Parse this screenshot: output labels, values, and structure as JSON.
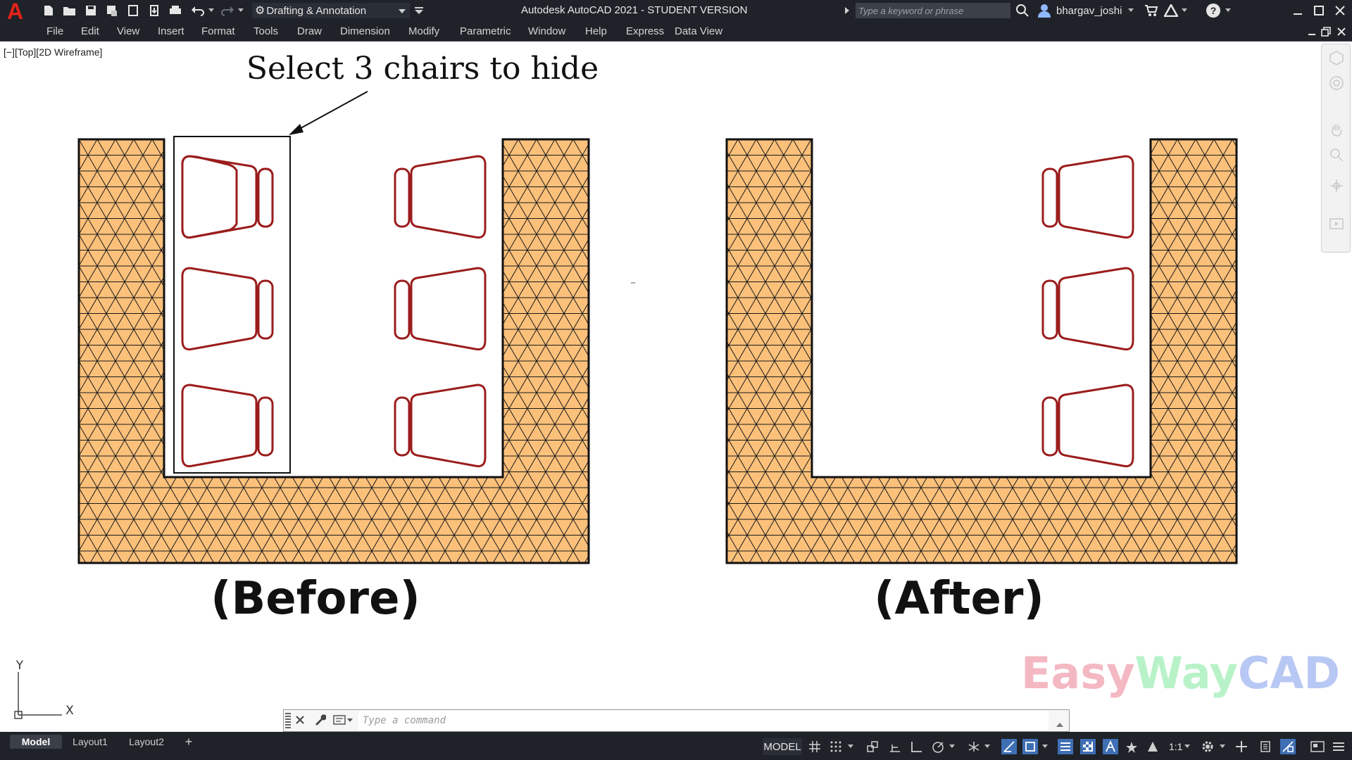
{
  "app": {
    "title": "Autodesk AutoCAD 2021 - STUDENT VERSION",
    "logo_letter": "A",
    "workspace": "Drafting & Annotation",
    "search_placeholder": "Type a keyword or phrase",
    "user": "bhargav_joshi",
    "help_symbol": "?"
  },
  "menu": [
    "File",
    "Edit",
    "View",
    "Insert",
    "Format",
    "Tools",
    "Draw",
    "Dimension",
    "Modify",
    "Parametric",
    "Window",
    "Help",
    "Express",
    "Data View"
  ],
  "viewport": {
    "label": "[−][Top][2D Wireframe]"
  },
  "drawing": {
    "annotation": "Select 3 chairs to hide",
    "before_label": "(Before)",
    "after_label": "(After)",
    "watermark": [
      "Easy",
      "Way",
      "CAD"
    ],
    "colors": {
      "hatch_fill": "#fbc07a",
      "chair": "#9b1c1c",
      "watermark_easy": "#f4b8c2",
      "watermark_way": "#b8f2c8",
      "watermark_cad": "#b8c8f4"
    }
  },
  "ucs": {
    "x": "X",
    "y": "Y"
  },
  "command": {
    "placeholder": "Type a command"
  },
  "tabs": [
    "Model",
    "Layout1",
    "Layout2"
  ],
  "status": {
    "model": "MODEL",
    "scale": "1:1"
  }
}
